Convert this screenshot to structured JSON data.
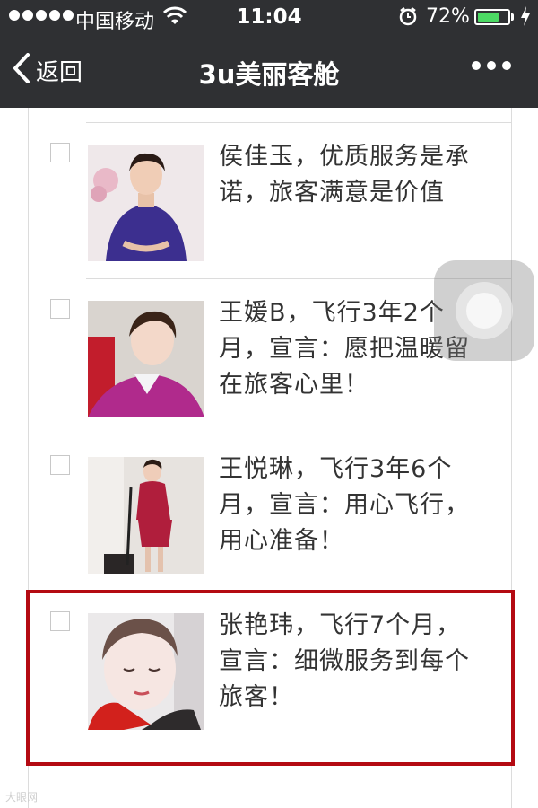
{
  "status_bar": {
    "carrier": "中国移动",
    "time": "11:04",
    "battery_percent": "72%",
    "battery_level": 0.72,
    "icons": [
      "signal-dots-icon",
      "wifi-icon",
      "alarm-clock-icon",
      "battery-icon",
      "charging-icon"
    ]
  },
  "nav": {
    "back_label": "返回",
    "title": "3u美丽客舱",
    "back_icon": "chevron-left-icon",
    "more_icon": "more-dots-icon"
  },
  "items": [
    {
      "caption": "侯佳玉，优质服务是承诺，旅客满意是价值",
      "photo": "stewardess-purple-uniform-photo",
      "highlighted": false
    },
    {
      "caption": "王媛B，飞行3年2个月，宣言：愿把温暖留在旅客心里！",
      "photo": "stewardess-pink-uniform-selfie-photo",
      "highlighted": false
    },
    {
      "caption": "王悦琳，飞行3年6个月，宣言：用心飞行，用心准备！",
      "photo": "stewardess-red-uniform-full-body-photo",
      "highlighted": false
    },
    {
      "caption": "张艳玮，飞行7个月，宣言：细微服务到每个旅客！",
      "photo": "stewardess-red-scarf-closeup-photo",
      "highlighted": true
    }
  ],
  "highlight_color": "#b40a12",
  "nav_bar_color": "#2f3033",
  "watermark": "大眼网",
  "assistive_touch_icon": "assistive-touch-icon"
}
